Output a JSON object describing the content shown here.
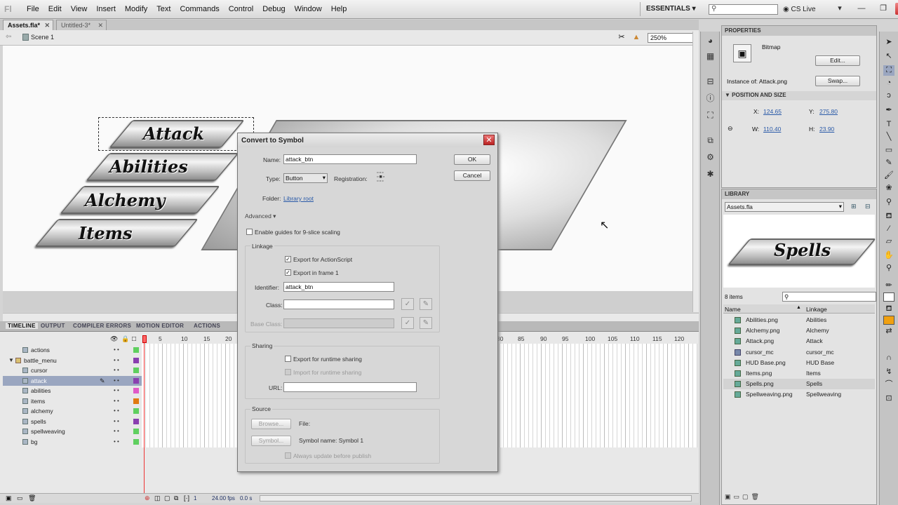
{
  "menubar": {
    "logo": "Fl",
    "items": [
      "File",
      "Edit",
      "View",
      "Insert",
      "Modify",
      "Text",
      "Commands",
      "Control",
      "Debug",
      "Window",
      "Help"
    ],
    "workspace": "ESSENTIALS ▾",
    "search_icon": "search-icon",
    "cs_live": "CS Live",
    "window_controls": [
      "▾",
      "—",
      "❐",
      "✕"
    ]
  },
  "doc_tabs": [
    {
      "label": "Assets.fla*",
      "close": "✕"
    },
    {
      "label": "Untitled-3*",
      "close": "✕"
    }
  ],
  "scene": {
    "back": "⇦",
    "label": "Scene 1",
    "zoom": "250%"
  },
  "stage": {
    "buttons": [
      "Attack",
      "Abilities",
      "Alchemy",
      "Items"
    ]
  },
  "timeline": {
    "tabs": [
      "TIMELINE",
      "OUTPUT",
      "COMPILER ERRORS",
      "MOTION EDITOR",
      "ACTIONS"
    ],
    "header_icons": [
      "👁",
      "🔒",
      "□"
    ],
    "frame_numbers": [
      "1",
      "5",
      "10",
      "15",
      "20",
      "80",
      "85",
      "90",
      "95",
      "100",
      "105",
      "110",
      "115",
      "120"
    ],
    "layers": [
      {
        "name": "actions",
        "color": "#5fcf5f"
      },
      {
        "name": "battle_menu",
        "color": "#8a3fb0",
        "folder": true
      },
      {
        "name": "cursor",
        "color": "#5fcf5f"
      },
      {
        "name": "attack",
        "color": "#8a3fb0",
        "selected": true
      },
      {
        "name": "abilities",
        "color": "#e05ac8"
      },
      {
        "name": "items",
        "color": "#e07a10"
      },
      {
        "name": "alchemy",
        "color": "#5fcf5f"
      },
      {
        "name": "spells",
        "color": "#8a3fb0"
      },
      {
        "name": "spellweaving",
        "color": "#5fcf5f"
      },
      {
        "name": "bg",
        "color": "#5fcf5f"
      }
    ],
    "layer_dots": "•   •",
    "status": {
      "frame": "1",
      "fps": "24.00 fps",
      "time": "0.0 s"
    }
  },
  "dialog": {
    "title": "Convert to Symbol",
    "close": "✕",
    "name_label": "Name:",
    "name_value": "attack_btn",
    "type_label": "Type:",
    "type_value": "Button",
    "registration_label": "Registration:",
    "folder_label": "Folder:",
    "folder_value": "Library root",
    "advanced": "Advanced ▾",
    "nine_slice": "Enable guides for 9-slice scaling",
    "linkage_title": "Linkage",
    "export_as": "Export for ActionScript",
    "export_frame1": "Export in frame 1",
    "identifier_label": "Identifier:",
    "identifier_value": "attack_btn",
    "class_label": "Class:",
    "class_value": "",
    "base_class_label": "Base Class:",
    "sharing_title": "Sharing",
    "export_runtime": "Export for runtime sharing",
    "import_runtime": "Import for runtime sharing",
    "url_label": "URL:",
    "source_title": "Source",
    "browse": "Browse...",
    "file_label": "File:",
    "symbol_btn": "Symbol...",
    "symbol_name": "Symbol name: Symbol 1",
    "always_update": "Always update before publish",
    "ok": "OK",
    "cancel": "Cancel",
    "check": "✓",
    "pencil": "✎"
  },
  "properties": {
    "header": "PROPERTIES",
    "type": "Bitmap",
    "edit": "Edit...",
    "instance_of": "Instance of: Attack.png",
    "swap": "Swap...",
    "pos_section": "▼ POSITION AND SIZE",
    "x_label": "X:",
    "x": "124.65",
    "y_label": "Y:",
    "y": "275.80",
    "w_label": "W:",
    "w": "110.40",
    "h_label": "H:",
    "h": "23.90"
  },
  "library": {
    "header": "LIBRARY",
    "doc": "Assets.fla",
    "preview": "Spells",
    "count": "8 items",
    "col_name": "Name",
    "col_linkage": "Linkage",
    "items": [
      {
        "name": "Abilities.png",
        "linkage": "Abilities",
        "kind": "bitmap"
      },
      {
        "name": "Alchemy.png",
        "linkage": "Alchemy",
        "kind": "bitmap"
      },
      {
        "name": "Attack.png",
        "linkage": "Attack",
        "kind": "bitmap"
      },
      {
        "name": "cursor_mc",
        "linkage": "cursor_mc",
        "kind": "movieclip"
      },
      {
        "name": "HUD Base.png",
        "linkage": "HUD Base",
        "kind": "bitmap"
      },
      {
        "name": "Items.png",
        "linkage": "Items",
        "kind": "bitmap"
      },
      {
        "name": "Spells.png",
        "linkage": "Spells",
        "kind": "bitmap",
        "selected": true
      },
      {
        "name": "Spellweaving.png",
        "linkage": "Spellweaving",
        "kind": "bitmap"
      }
    ]
  },
  "colors": {
    "fill": "#f0a010",
    "stroke": "#222222"
  }
}
